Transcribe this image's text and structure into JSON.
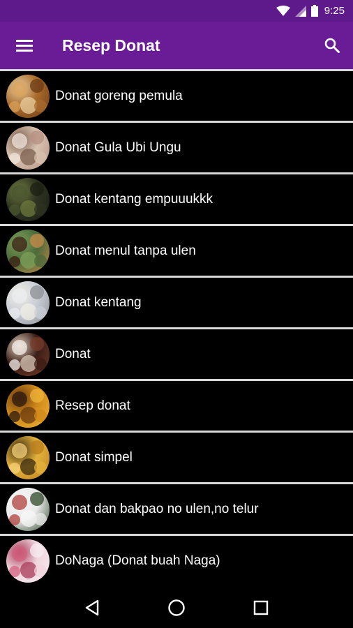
{
  "status_bar": {
    "time": "9:25"
  },
  "app_bar": {
    "title": "Resep Donat",
    "menu_icon": "menu-icon",
    "search_icon": "search-icon"
  },
  "recipes": [
    {
      "title": "Donat goreng pemula",
      "thumb_colors": [
        "#a86a2c",
        "#d9a25a",
        "#6b3a14",
        "#e9cfa0"
      ]
    },
    {
      "title": "Donat Gula Ubi Ungu",
      "thumb_colors": [
        "#d8c2b0",
        "#f1e6de",
        "#b58f80",
        "#7b5f4f"
      ]
    },
    {
      "title": "Donat kentang empuuukkk",
      "thumb_colors": [
        "#2d3320",
        "#4a5530",
        "#1b1f14",
        "#6e7a3e"
      ]
    },
    {
      "title": "Donat menul tanpa ulen",
      "thumb_colors": [
        "#4b6a3a",
        "#3a1f14",
        "#c98b4a",
        "#7fa05a"
      ]
    },
    {
      "title": "Donat kentang",
      "thumb_colors": [
        "#c9ced6",
        "#e9ecef",
        "#8c8f94",
        "#f2efe6"
      ]
    },
    {
      "title": "Donat",
      "thumb_colors": [
        "#3b1e16",
        "#f3efe9",
        "#7a3b2a",
        "#d9c8b8"
      ]
    },
    {
      "title": "Resep donat",
      "thumb_colors": [
        "#d08a1a",
        "#2b1a0e",
        "#f0b43a",
        "#6a3a10"
      ]
    },
    {
      "title": "Donat simpel",
      "thumb_colors": [
        "#e3b23c",
        "#f6d27a",
        "#b97c1e",
        "#3a2a10"
      ]
    },
    {
      "title": "Donat dan bakpao no ulen,no telur",
      "thumb_colors": [
        "#eaeaea",
        "#b0413e",
        "#2f4a2a",
        "#f7f7f7"
      ]
    },
    {
      "title": "DoNaga (Donat buah Naga)",
      "thumb_colors": [
        "#f0d6de",
        "#d4607f",
        "#f7eef1",
        "#a83a58"
      ]
    }
  ],
  "nav_bar": {
    "back_icon": "back-icon",
    "home_icon": "home-icon",
    "recents_icon": "recents-icon"
  },
  "colors": {
    "status_bar": "#5e1a8a",
    "app_bar": "#6a1b96",
    "background": "#000000",
    "divider": "#d8d8d8"
  }
}
